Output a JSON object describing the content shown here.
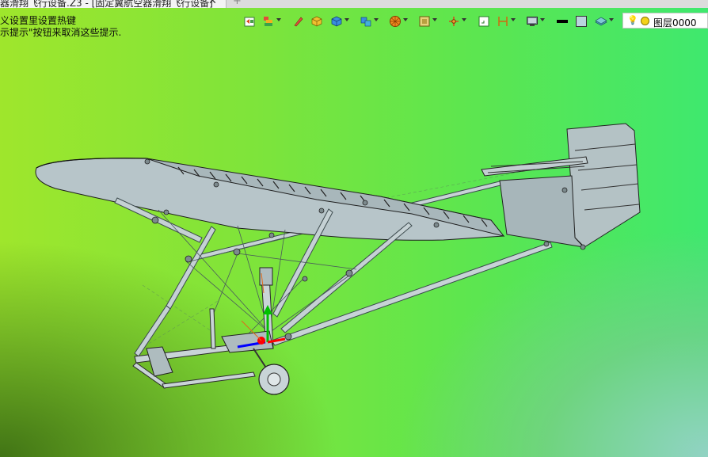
{
  "document_tab": {
    "title": "器滑翔飞行设备.Z3 - [固定翼航空器滑翔飞行设备]",
    "close_glyph": "✕",
    "new_tab_glyph": "+"
  },
  "hints": {
    "line1": "义设置里设置热键",
    "line2": "示提示\"按钮来取消这些提示."
  },
  "toolbar": {
    "items": [
      {
        "id": "tb-layer-tool",
        "icon": "layer-panel-icon"
      },
      {
        "id": "tb-flow",
        "icon": "stack-colors-icon"
      },
      {
        "id": "tb-pen",
        "icon": "pen-icon"
      },
      {
        "id": "tb-box-yellow",
        "icon": "yellow-cube-icon"
      },
      {
        "id": "tb-box-blue",
        "icon": "blue-cube-icon"
      },
      {
        "id": "tb-box-multi",
        "icon": "multi-cube-icon"
      },
      {
        "id": "tb-render",
        "icon": "render-sphere-icon"
      },
      {
        "id": "tb-texture",
        "icon": "texture-square-icon"
      },
      {
        "id": "tb-orient",
        "icon": "orientation-icon"
      },
      {
        "id": "tb-view-frame",
        "icon": "view-frame-icon"
      },
      {
        "id": "tb-section",
        "icon": "section-bracket-icon"
      },
      {
        "id": "tb-display",
        "icon": "display-monitor-icon"
      },
      {
        "id": "tb-linecolor",
        "icon": "line-color-icon"
      },
      {
        "id": "tb-fillcolor",
        "icon": "fill-color-icon"
      },
      {
        "id": "tb-layers",
        "icon": "layers-icon"
      }
    ],
    "layer_combo": {
      "value": "图层0000",
      "icons": [
        "bulb-icon",
        "layer-color-dot-icon"
      ]
    }
  },
  "colors": {
    "model_fill": "#b5c3c6",
    "model_stroke": "#222222",
    "axis_red": "#ff0000",
    "axis_green": "#00c000",
    "axis_blue": "#0000ff",
    "accent_orange": "#e06a1a"
  }
}
